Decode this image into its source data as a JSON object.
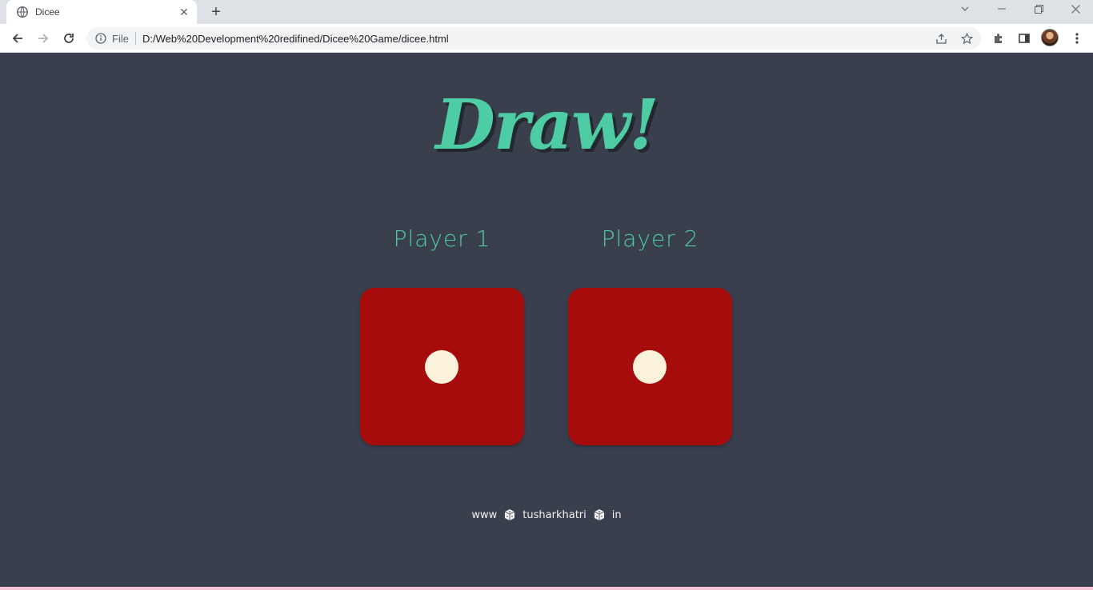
{
  "browser": {
    "tab_title": "Dicee",
    "tab_close": "✕",
    "new_tab": "+",
    "scheme_label": "File",
    "url": "D:/Web%20Development%20redifined/Dicee%20Game/dicee.html",
    "icons": [
      "globe-icon",
      "back-icon",
      "forward-icon",
      "reload-icon",
      "info-icon",
      "share-icon",
      "star-icon",
      "extensions-icon",
      "sidepanel-icon",
      "menu-icon"
    ]
  },
  "page": {
    "title": "Draw!",
    "players": [
      {
        "name": "Player 1",
        "die_value": 1
      },
      {
        "name": "Player 2",
        "die_value": 1
      }
    ],
    "footer": {
      "part1": "www",
      "part2": "tusharkhatri",
      "part3": "in"
    },
    "colors": {
      "background": "#393f4d",
      "accent": "#4ecca3",
      "die": "#a70c0c",
      "pip": "#fbf2dc"
    }
  }
}
